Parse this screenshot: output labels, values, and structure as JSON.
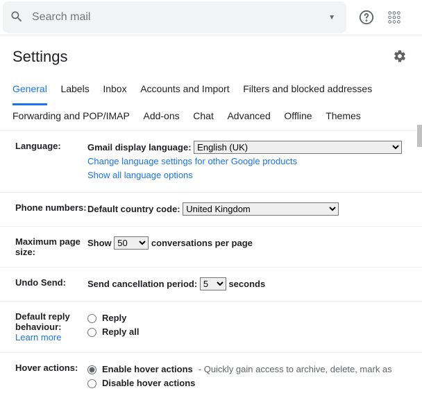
{
  "search": {
    "placeholder": "Search mail"
  },
  "header": {
    "title": "Settings"
  },
  "tabs": {
    "general": "General",
    "labels": "Labels",
    "inbox": "Inbox",
    "accounts": "Accounts and Import",
    "filters": "Filters and blocked addresses",
    "forwarding": "Forwarding and POP/IMAP",
    "addons": "Add-ons",
    "chat": "Chat",
    "advanced": "Advanced",
    "offline": "Offline",
    "themes": "Themes"
  },
  "language": {
    "label": "Language:",
    "display_lang_label": "Gmail display language:",
    "selected": "English (UK)",
    "change_link": "Change language settings for other Google products",
    "show_all_link": "Show all language options"
  },
  "phone": {
    "label": "Phone numbers:",
    "code_label": "Default country code:",
    "selected": "United Kingdom"
  },
  "pagesize": {
    "label": "Maximum page size:",
    "show": "Show",
    "value": "50",
    "suffix": "conversations per page"
  },
  "undo": {
    "label": "Undo Send:",
    "period_label": "Send cancellation period:",
    "value": "5",
    "suffix": "seconds"
  },
  "reply": {
    "label": "Default reply behaviour:",
    "learn_more": "Learn more",
    "opt1": "Reply",
    "opt2": "Reply all"
  },
  "hover": {
    "label": "Hover actions:",
    "opt1": "Enable hover actions",
    "opt1_desc": " - Quickly gain access to archive, delete, mark as",
    "opt2": "Disable hover actions"
  }
}
